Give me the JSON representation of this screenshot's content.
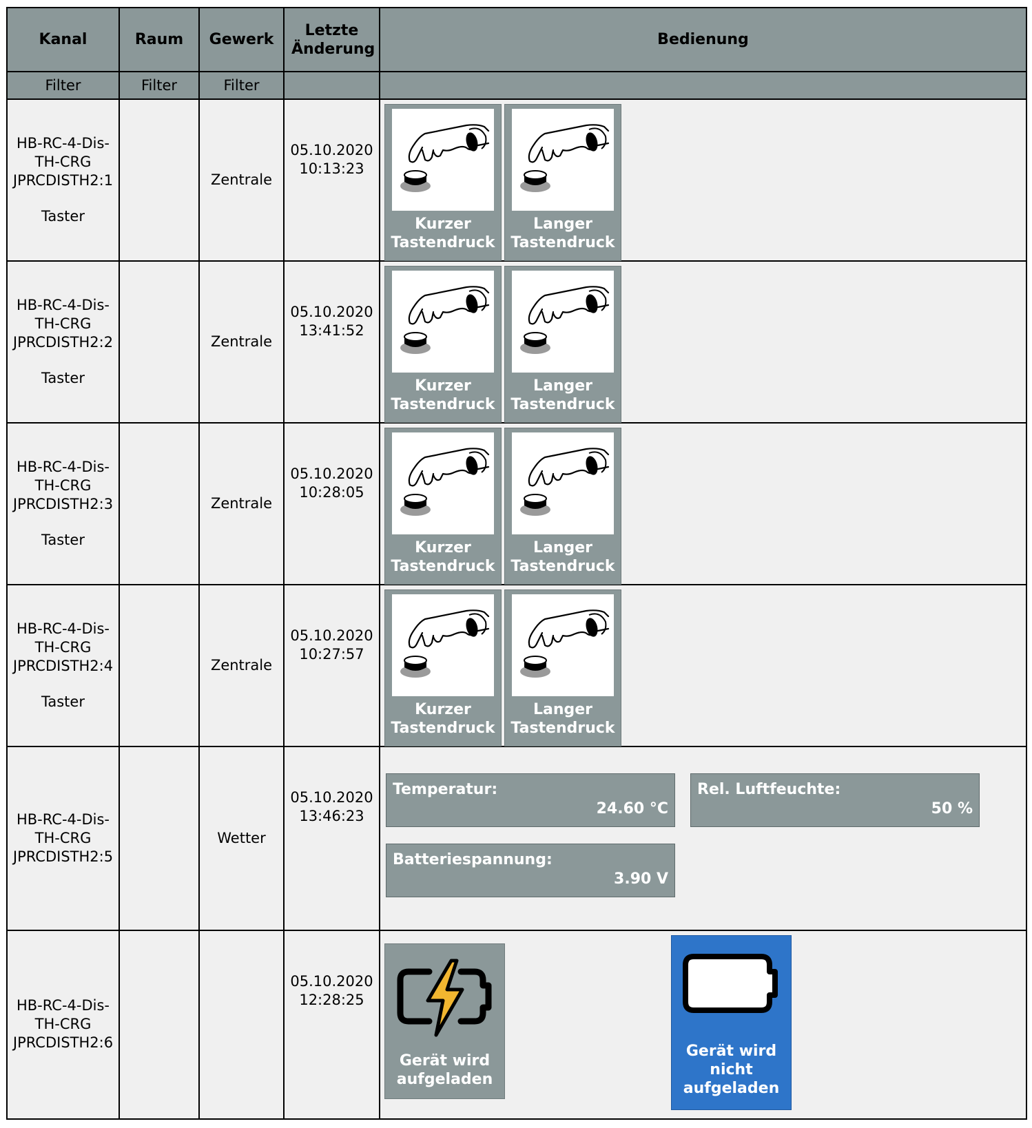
{
  "header": {
    "kanal": "Kanal",
    "raum": "Raum",
    "gewerk": "Gewerk",
    "letzte_aenderung": "Letzte Änderung",
    "bedienung": "Bedienung"
  },
  "filters": {
    "kanal": "Filter",
    "raum": "Filter",
    "gewerk": "Filter"
  },
  "rows": [
    {
      "name": "HB-RC-4-Dis-TH-CRG JPRCDISTH2:1",
      "type": "Taster",
      "raum": "",
      "gewerk": "Zentrale",
      "date": "05.10.2020",
      "time": "10:13:23",
      "short_label": "Kurzer Tastendruck",
      "long_label": "Langer Tastendruck"
    },
    {
      "name": "HB-RC-4-Dis-TH-CRG JPRCDISTH2:2",
      "type": "Taster",
      "raum": "",
      "gewerk": "Zentrale",
      "date": "05.10.2020",
      "time": "13:41:52",
      "short_label": "Kurzer Tastendruck",
      "long_label": "Langer Tastendruck"
    },
    {
      "name": "HB-RC-4-Dis-TH-CRG JPRCDISTH2:3",
      "type": "Taster",
      "raum": "",
      "gewerk": "Zentrale",
      "date": "05.10.2020",
      "time": "10:28:05",
      "short_label": "Kurzer Tastendruck",
      "long_label": "Langer Tastendruck"
    },
    {
      "name": "HB-RC-4-Dis-TH-CRG JPRCDISTH2:4",
      "type": "Taster",
      "raum": "",
      "gewerk": "Zentrale",
      "date": "05.10.2020",
      "time": "10:27:57",
      "short_label": "Kurzer Tastendruck",
      "long_label": "Langer Tastendruck"
    },
    {
      "name": "HB-RC-4-Dis-TH-CRG JPRCDISTH2:5",
      "raum": "",
      "gewerk": "Wetter",
      "date": "05.10.2020",
      "time": "13:46:23",
      "temperature": {
        "label": "Temperatur:",
        "value": "24.60 °C"
      },
      "humidity": {
        "label": "Rel. Luftfeuchte:",
        "value": "50 %"
      },
      "battery": {
        "label": "Batteriespannung:",
        "value": "3.90 V"
      }
    },
    {
      "name": "HB-RC-4-Dis-TH-CRG JPRCDISTH2:6",
      "raum": "",
      "gewerk": "",
      "date": "05.10.2020",
      "time": "12:28:25",
      "charging_label": "Gerät wird aufgeladen",
      "not_charging_label": "Gerät wird nicht aufgeladen",
      "active_state": "not_charging"
    }
  ],
  "icons": {
    "press": "finger-press-button-icon",
    "charging": "battery-charging-icon",
    "not_charging": "battery-empty-icon"
  },
  "colors": {
    "header_bg": "#8b9899",
    "cell_bg": "#f0f0f0",
    "active_blue": "#2e75c9"
  }
}
